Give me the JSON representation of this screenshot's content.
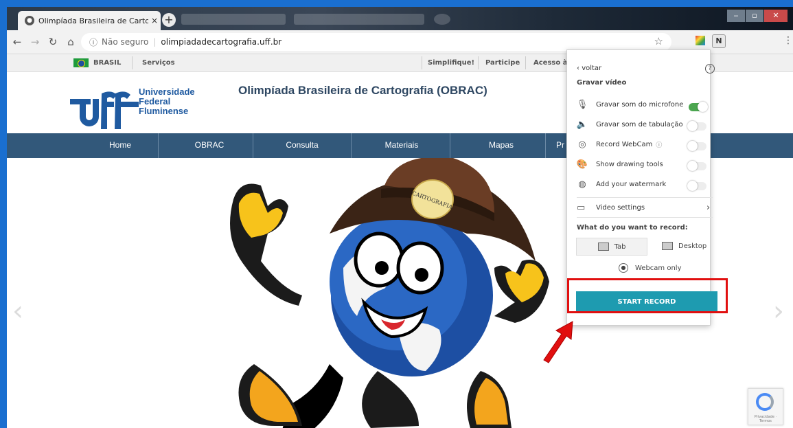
{
  "browser": {
    "tab_title": "Olimpíada Brasileira de Cartograf",
    "tab_close": "×",
    "new_tab": "+",
    "omnibox": {
      "security_label": "Não seguro",
      "url": "olimpiadadecartografia.uff.br"
    }
  },
  "govbar": {
    "country": "BRASIL",
    "services": "Serviços",
    "links": [
      "Simplifique!",
      "Participe",
      "Acesso à"
    ]
  },
  "site": {
    "logo_lines": [
      "Universidade",
      "Federal",
      "Fluminense"
    ],
    "title": "Olimpíada Brasileira de Cartografia (OBRAC)",
    "nav": [
      "Home",
      "OBRAC",
      "Consulta",
      "Materiais",
      "Mapas",
      "Pr"
    ],
    "mascot_hat_text": "CARTOGRAFIA"
  },
  "popup": {
    "back_label": "voltar",
    "section_title": "Gravar vídeo",
    "options": [
      {
        "label": "Gravar som do microfone",
        "icon": "microphone-icon",
        "on": true
      },
      {
        "label": "Gravar som de tabulação",
        "icon": "speaker-icon",
        "on": false
      },
      {
        "label": "Record WebCam",
        "icon": "webcam-icon",
        "on": false
      },
      {
        "label": "Show drawing tools",
        "icon": "palette-icon",
        "on": false
      },
      {
        "label": "Add your watermark",
        "icon": "watermark-icon",
        "on": false
      }
    ],
    "video_settings": "Video settings",
    "record_question": "What do you want to record:",
    "choices": {
      "tab": "Tab",
      "desktop": "Desktop",
      "webcam": "Webcam only"
    },
    "start_button": "START RECORD"
  },
  "colors": {
    "nav_bg": "#32587a",
    "start_button": "#1e9bb0",
    "toggle_on": "#4ba64f",
    "highlight": "#e10f0f"
  }
}
